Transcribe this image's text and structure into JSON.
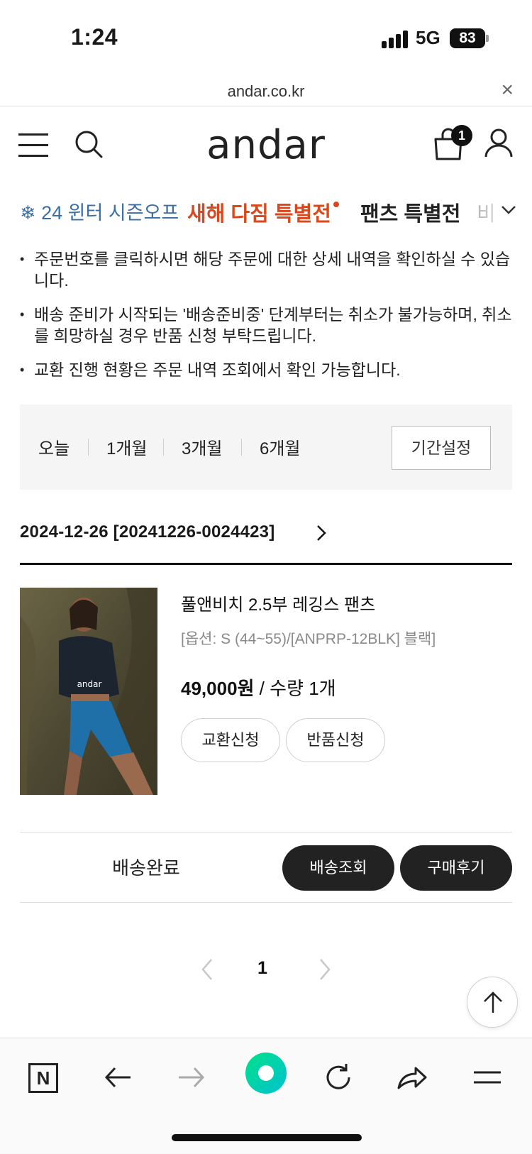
{
  "status_bar": {
    "time": "1:24",
    "network": "5G",
    "battery": "83"
  },
  "browser": {
    "url": "andar.co.kr",
    "close_label": "×"
  },
  "header": {
    "logo": "andar",
    "cart_count": "1"
  },
  "categories": [
    {
      "label": "24 윈터 시즌오프",
      "icon": "snowflake-icon"
    },
    {
      "label": "새해 다짐 특별전"
    },
    {
      "label": "팬츠 특별전"
    },
    {
      "label": "비"
    }
  ],
  "notices": [
    "주문번호를 클릭하시면 해당 주문에 대한 상세 내역을 확인하실 수 있습니다.",
    "배송 준비가 시작되는 '배송준비중' 단계부터는 취소가 불가능하며, 취소를 희망하실 경우 반품 신청 부탁드립니다.",
    "교환 진행 현황은 주문 내역 조회에서 확인 가능합니다."
  ],
  "period_filter": {
    "options": [
      "오늘",
      "1개월",
      "3개월",
      "6개월"
    ],
    "custom_label": "기간설정"
  },
  "order": {
    "header": "2024-12-26 [20241226-0024423]",
    "product": {
      "name": "풀앤비치 2.5부 레깅스 팬츠",
      "option": "[옵션: S (44~55)/[ANPRP-12BLK] 블랙]",
      "price": "49,000원",
      "quantity": " / 수량 1개",
      "image_logo": "andar"
    },
    "actions": {
      "exchange": "교환신청",
      "return": "반품신청"
    },
    "delivery": {
      "status": "배송완료",
      "track_label": "배송조회",
      "review_label": "구매후기"
    }
  },
  "pagination": {
    "current": "1"
  },
  "toolbar": {
    "n_label": "N"
  },
  "colors": {
    "accent_red": "#d8481c",
    "season_blue": "#3b6ea4",
    "dark_button": "#222222",
    "toolbar_green": "#00e08a"
  }
}
